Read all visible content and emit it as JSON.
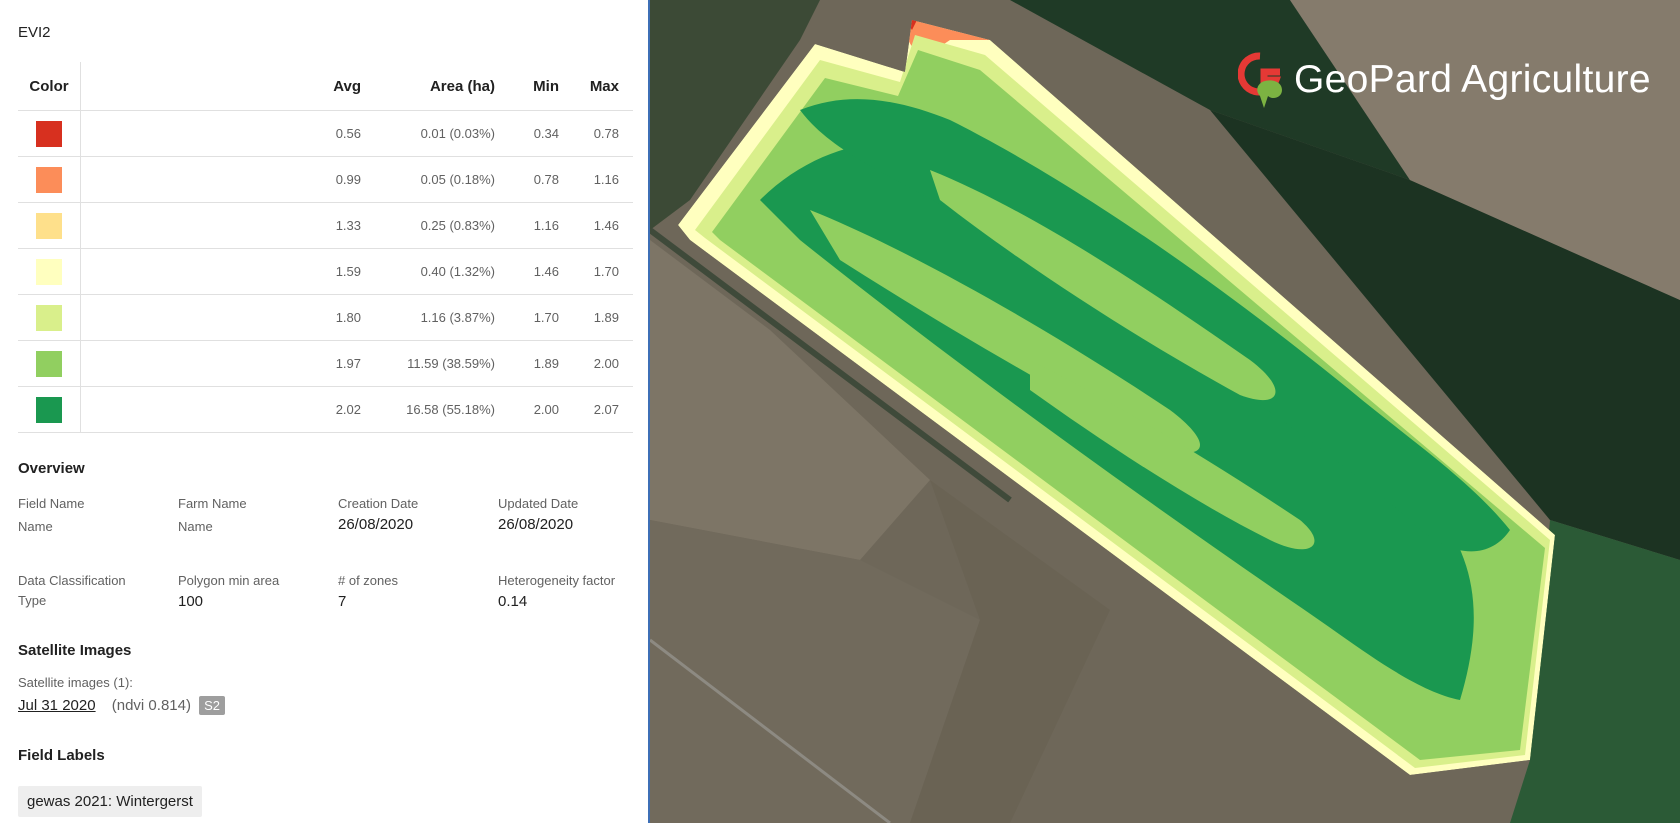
{
  "panel": {
    "layer_title": "EVI2",
    "table": {
      "headers": {
        "color": "Color",
        "avg": "Avg",
        "area": "Area (ha)",
        "min": "Min",
        "max": "Max"
      },
      "rows": [
        {
          "color": "#d7301f",
          "avg": "0.56",
          "area": "0.01 (0.03%)",
          "min": "0.34",
          "max": "0.78"
        },
        {
          "color": "#fc8d59",
          "avg": "0.99",
          "area": "0.05 (0.18%)",
          "min": "0.78",
          "max": "1.16"
        },
        {
          "color": "#fee08b",
          "avg": "1.33",
          "area": "0.25 (0.83%)",
          "min": "1.16",
          "max": "1.46"
        },
        {
          "color": "#ffffbf",
          "avg": "1.59",
          "area": "0.40 (1.32%)",
          "min": "1.46",
          "max": "1.70"
        },
        {
          "color": "#d9ef8b",
          "avg": "1.80",
          "area": "1.16 (3.87%)",
          "min": "1.70",
          "max": "1.89"
        },
        {
          "color": "#91cf60",
          "avg": "1.97",
          "area": "11.59 (38.59%)",
          "min": "1.89",
          "max": "2.00"
        },
        {
          "color": "#1a9850",
          "avg": "2.02",
          "area": "16.58 (55.18%)",
          "min": "2.00",
          "max": "2.07"
        }
      ]
    },
    "overview": {
      "title": "Overview",
      "field_name_label": "Field Name",
      "field_name_value": "Name",
      "farm_name_label": "Farm Name",
      "farm_name_value": "Name",
      "creation_date_label": "Creation Date",
      "creation_date_value": "26/08/2020",
      "updated_date_label": "Updated Date",
      "updated_date_value": "26/08/2020",
      "classification_label": "Data Classification",
      "classification_value": "Type",
      "polygon_label": "Polygon min area",
      "polygon_value": "100",
      "zones_label": "# of zones",
      "zones_value": "7",
      "hetero_label": "Heterogeneity factor",
      "hetero_value": "0.14"
    },
    "satellite": {
      "title": "Satellite Images",
      "count_label": "Satellite images (1):",
      "image_date": "Jul 31 2020",
      "ndvi": "(ndvi 0.814)",
      "source_badge": "S2"
    },
    "labels": {
      "title": "Field Labels",
      "chip": "gewas 2021: Wintergerst"
    }
  },
  "map": {
    "brand_name": "GeoPard Agriculture",
    "zone_colors": [
      "#d7301f",
      "#fc8d59",
      "#fee08b",
      "#ffffbf",
      "#d9ef8b",
      "#91cf60",
      "#1a9850"
    ]
  }
}
